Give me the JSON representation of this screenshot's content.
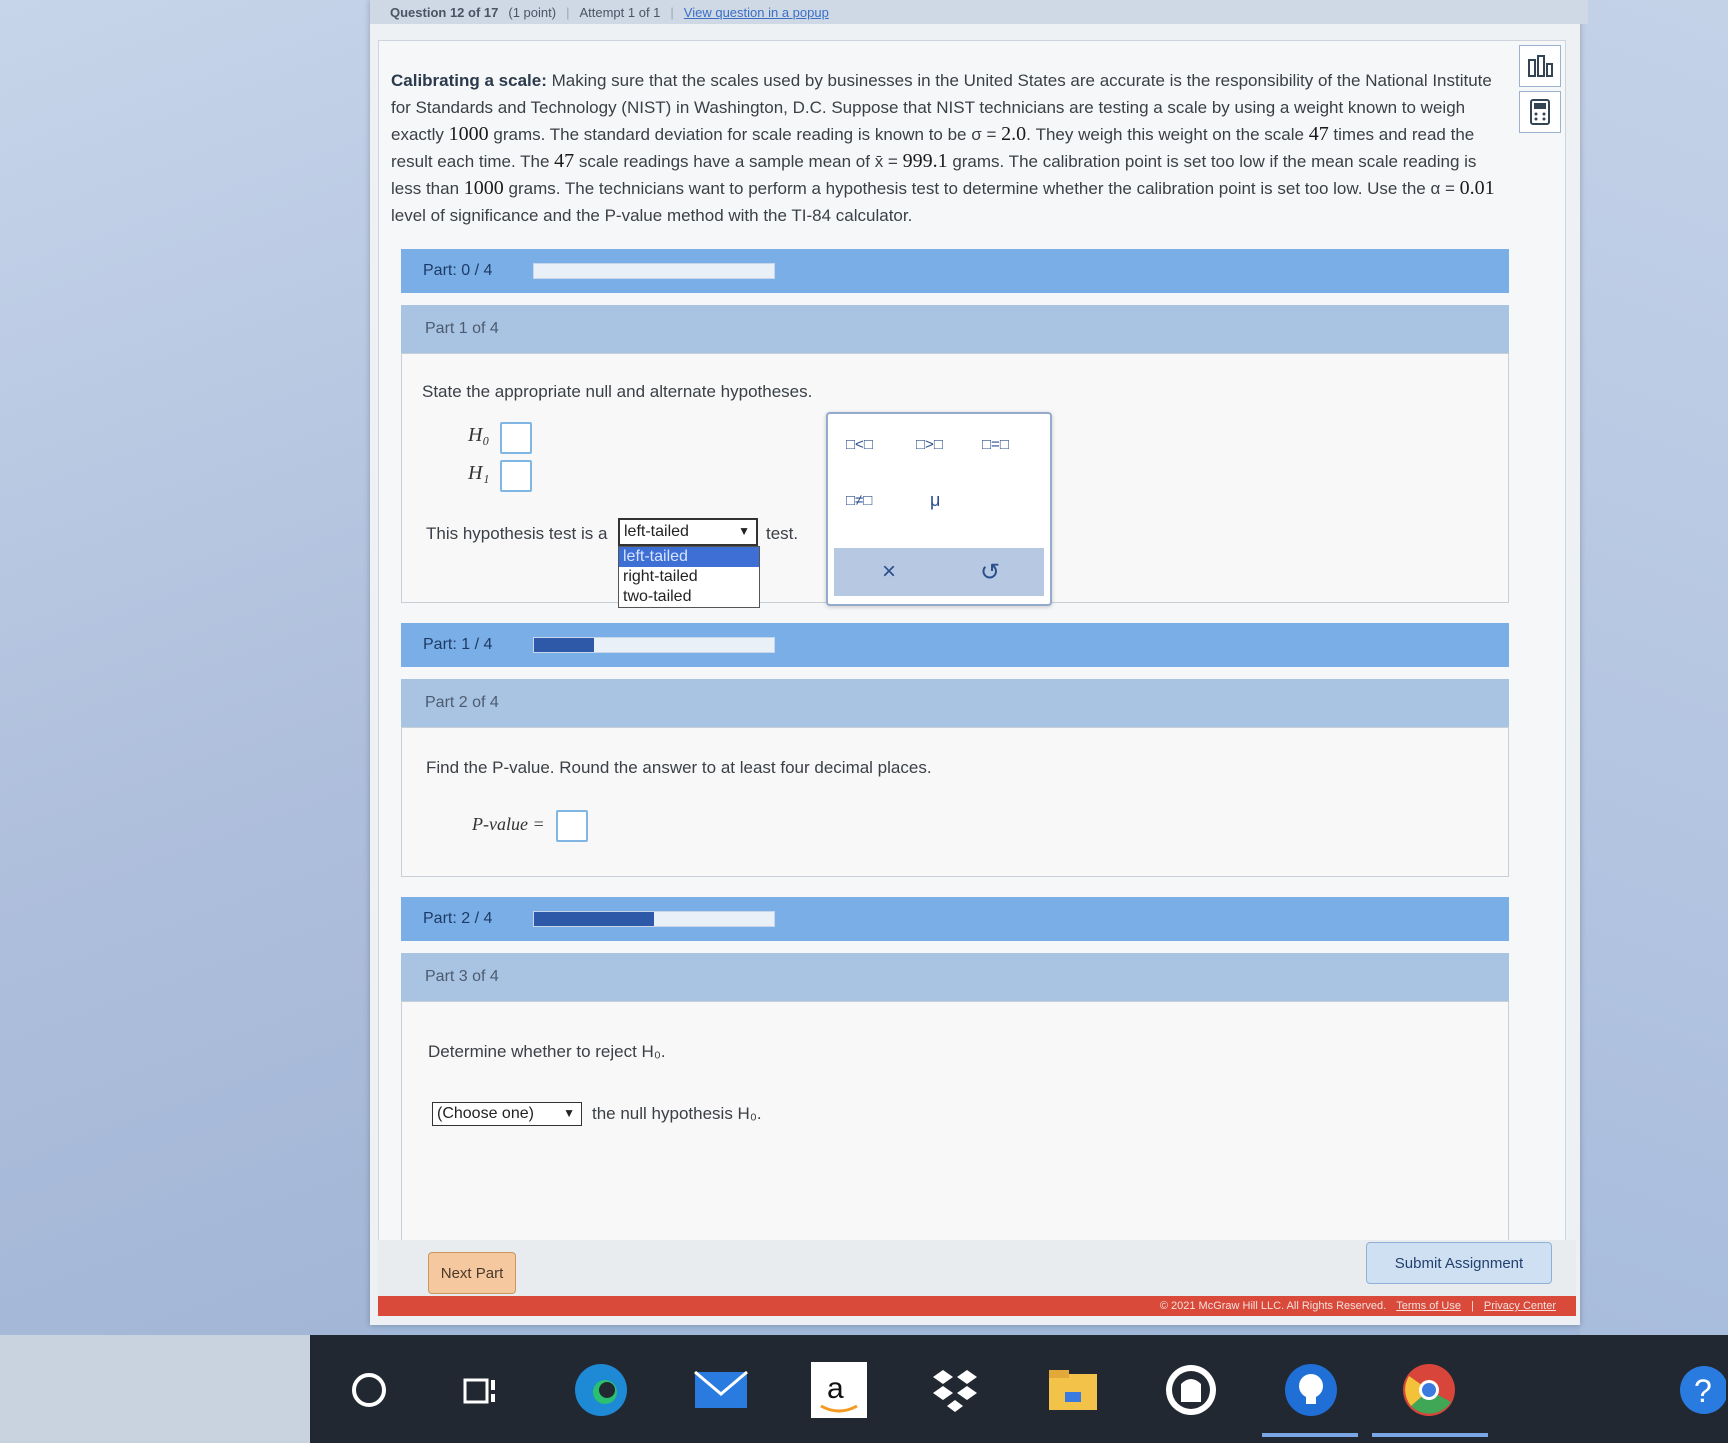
{
  "topbar": {
    "question": "Question 12 of 17",
    "points": "(1 point)",
    "attempt": "Attempt 1 of 1",
    "popup_link": "View question in a popup"
  },
  "tools": {
    "icon1": "data-icon",
    "icon2": "calculator-icon"
  },
  "problem": {
    "title": "Calibrating a scale:",
    "t1": "Making sure that the scales used by businesses in the United States are accurate is the responsibility of the National Institute for Standards and Technology (NIST) in Washington, D.C. Suppose that NIST technicians are testing a scale by using a weight known to weigh exactly",
    "weight": "1000",
    "t2": "grams. The standard deviation for scale reading is known to be σ =",
    "sigma": "2.0",
    "t3": ". They weigh this weight on the scale",
    "n": "47",
    "t4": "times and read the result each time. The",
    "n2": "47",
    "t5": "scale readings have a sample mean of x̄ =",
    "xbar": "999.1",
    "t6": "grams. The calibration point is set too low if the mean scale reading is less than",
    "weight2": "1000",
    "t7": "grams. The technicians want to perform a hypothesis test to determine whether the calibration point is set too low. Use the α =",
    "alpha": "0.01",
    "t8": "level of significance and the P-value method with the TI-84 calculator."
  },
  "progress": [
    {
      "label": "Part: 0 / 4",
      "fraction": 0.0
    },
    {
      "label": "Part: 1 / 4",
      "fraction": 0.25
    },
    {
      "label": "Part: 2 / 4",
      "fraction": 0.5
    }
  ],
  "part1": {
    "header": "Part 1 of 4",
    "instruction": "State the appropriate null and alternate hypotheses.",
    "h0": "H₀",
    "h1": "H₁",
    "test_prefix": "This hypothesis test is a",
    "test_selected": "left-tailed",
    "test_suffix": "test.",
    "options": [
      "left-tailed",
      "right-tailed",
      "two-tailed"
    ],
    "palette": {
      "lt": "□<□",
      "gt": "□>□",
      "eq": "□=□",
      "ne": "□≠□",
      "mu": "μ",
      "clear": "×",
      "undo": "↺"
    }
  },
  "part2": {
    "header": "Part 2 of 4",
    "instruction": "Find the P-value. Round the answer to at least four decimal places.",
    "pvalue_label": "P-value ="
  },
  "part3": {
    "header": "Part 3 of 4",
    "instruction": "Determine whether to reject H₀.",
    "choose": "(Choose one)",
    "after": "the null hypothesis H₀."
  },
  "buttons": {
    "next": "Next Part",
    "submit": "Submit Assignment"
  },
  "footer": {
    "copyright": "© 2021 McGraw Hill LLC. All Rights Reserved.",
    "terms": "Terms of Use",
    "privacy": "Privacy Center"
  }
}
